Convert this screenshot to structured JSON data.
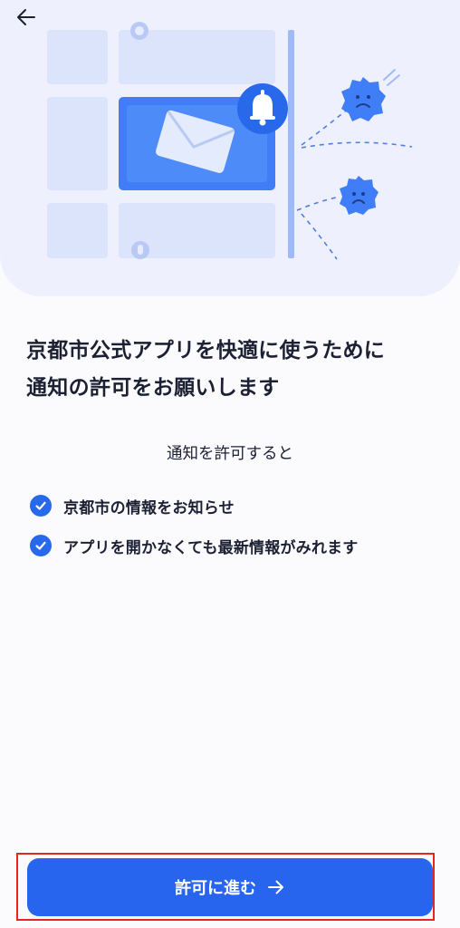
{
  "header": {
    "back_icon": "arrow-left-icon"
  },
  "illustration": {
    "icons": [
      "mail-icon",
      "bell-icon",
      "map-pin-icon",
      "frown-badge-icon"
    ],
    "colors": {
      "background": "#eef0fd",
      "tile": "#dce4fc",
      "accent": "#3f7ef6",
      "dark_accent": "#2769ea"
    }
  },
  "content": {
    "title_line1": "京都市公式アプリを快適に使うために",
    "title_line2": "通知の許可をお願いします",
    "subtitle": "通知を許可すると",
    "benefits": [
      {
        "label": "京都市の情報をお知らせ",
        "icon": "check-circle-icon"
      },
      {
        "label": "アプリを開かなくても最新情報がみれます",
        "icon": "check-circle-icon"
      }
    ]
  },
  "cta": {
    "label": "許可に進む",
    "icon": "arrow-right-icon",
    "color": "#2765ef"
  }
}
